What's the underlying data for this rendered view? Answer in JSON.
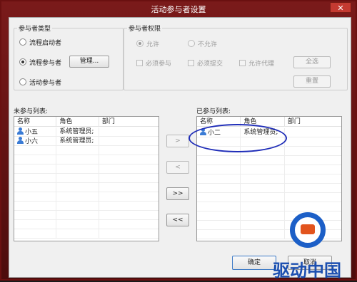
{
  "window": {
    "title": "活动参与者设置",
    "close_glyph": "✕"
  },
  "participant_type": {
    "legend": "参与者类型",
    "options": [
      {
        "label": "流程启动者",
        "checked": false
      },
      {
        "label": "流程参与者",
        "checked": true
      },
      {
        "label": "活动参与者",
        "checked": false
      }
    ],
    "manage_button": "管理..."
  },
  "permissions": {
    "legend": "参与者权限",
    "allow": "允许",
    "deny": "不允许",
    "checks": [
      "必须参与",
      "必须提交",
      "允许代理"
    ],
    "select_all": "全选",
    "reset": "重置"
  },
  "not_participating": {
    "label": "未参与列表:",
    "columns": [
      "名称",
      "角色",
      "部门"
    ],
    "rows": [
      {
        "name": "小五",
        "role": "系统管理员;",
        "dept": ""
      },
      {
        "name": "小六",
        "role": "系统管理员;",
        "dept": ""
      }
    ]
  },
  "participating": {
    "label": "已参与列表:",
    "columns": [
      "名称",
      "角色",
      "部门"
    ],
    "rows": [
      {
        "name": "小二",
        "role": "系统管理员;",
        "dept": ""
      }
    ]
  },
  "move_buttons": {
    "add": ">",
    "remove": "<",
    "add_all": ">>",
    "remove_all": "<<"
  },
  "footer": {
    "ok": "确定",
    "cancel": "取消"
  },
  "watermark": {
    "text": "驱动中国",
    "icon": "q-logo-icon"
  },
  "colors": {
    "title_bar": "#6a1010",
    "annotation": "#1f2db8",
    "watermark": "#1c4fb0"
  }
}
